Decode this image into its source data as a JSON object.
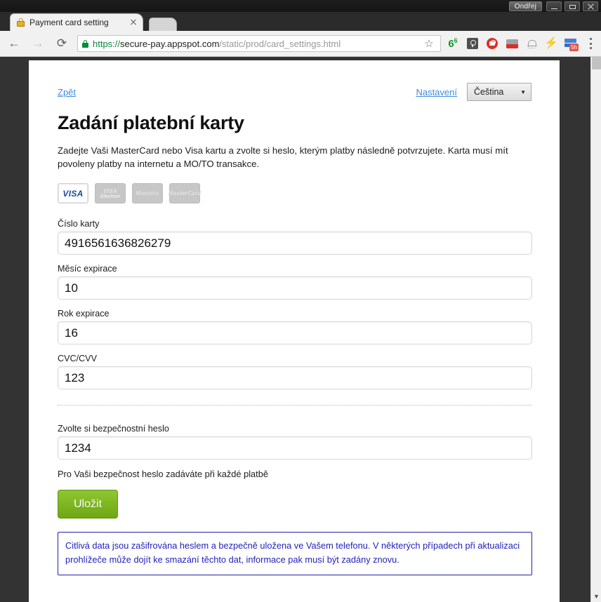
{
  "window": {
    "user_label": "Ondřej",
    "minimize_label": "Minimize",
    "maximize_label": "Maximize",
    "close_label": "Close"
  },
  "browser": {
    "tab": {
      "title": "Payment card setting",
      "close_label": "×"
    },
    "nav": {
      "back": "←",
      "forward": "→",
      "reload": "⟳"
    },
    "omnibox": {
      "scheme": "https://",
      "host": "secure-pay.appspot.com",
      "path": "/static/prod/card_settings.html",
      "star": "☆"
    },
    "extensions": [
      {
        "name": "count-badge-icon",
        "label": "6",
        "sup": "6"
      },
      {
        "name": "bulb-icon",
        "label": ""
      },
      {
        "name": "red-lock-icon",
        "label": ""
      },
      {
        "name": "card-icon",
        "label": ""
      },
      {
        "name": "bell-icon",
        "label": ""
      },
      {
        "name": "bolt-icon",
        "label": "⚡"
      },
      {
        "name": "flag-icon",
        "label": "",
        "badge": "5h"
      }
    ],
    "menu_label": "⋮"
  },
  "page": {
    "back_link": "Zpět",
    "settings_link": "Nastavení",
    "language": {
      "value": "Čeština",
      "caret": "▼"
    },
    "title": "Zadání platební karty",
    "intro": "Zadejte Vaši MasterCard nebo Visa kartu a zvolte si heslo, kterým platby následně potvrzujete. Karta musí mít povoleny platby na internetu a MO/TO transakce.",
    "cards": [
      {
        "name": "visa-logo",
        "line1": "VISA",
        "line2": "",
        "state": "active"
      },
      {
        "name": "visa-electron-logo",
        "line1": "VISA",
        "line2": "Electron",
        "state": "dim"
      },
      {
        "name": "maestro-logo",
        "line1": "Maestro",
        "line2": "",
        "state": "dim"
      },
      {
        "name": "mastercard-logo",
        "line1": "MasterCard",
        "line2": "",
        "state": "dim"
      }
    ],
    "fields": [
      {
        "name": "card-number",
        "label": "Číslo karty",
        "value": "4916561636826279",
        "placeholder": ""
      },
      {
        "name": "expiry-month",
        "label": "Měsíc expirace",
        "value": "10",
        "placeholder": ""
      },
      {
        "name": "expiry-year",
        "label": "Rok expirace",
        "value": "16",
        "placeholder": ""
      },
      {
        "name": "cvc",
        "label": "CVC/CVV",
        "value": "123",
        "placeholder": ""
      }
    ],
    "password": {
      "label": "Zvolte si bezpečnostní heslo",
      "value": "1234",
      "placeholder": "",
      "hint": "Pro Vaši bezpečnost heslo zadáváte při každé platbě"
    },
    "save_button": "Uložit",
    "info_notice": "Citlivá data jsou zašifrována heslem a bezpečně uložena ve Vašem telefonu. V některých případech při aktualizaci prohlížeče může dojít ke smazání těchto dat, informace pak musí být zadány znovu.",
    "scrollbar_down": "▼"
  },
  "colors": {
    "link": "#3f8ddb",
    "save_button": "#7fb520",
    "notice_text": "#2222bb",
    "page_background": "#333333"
  }
}
